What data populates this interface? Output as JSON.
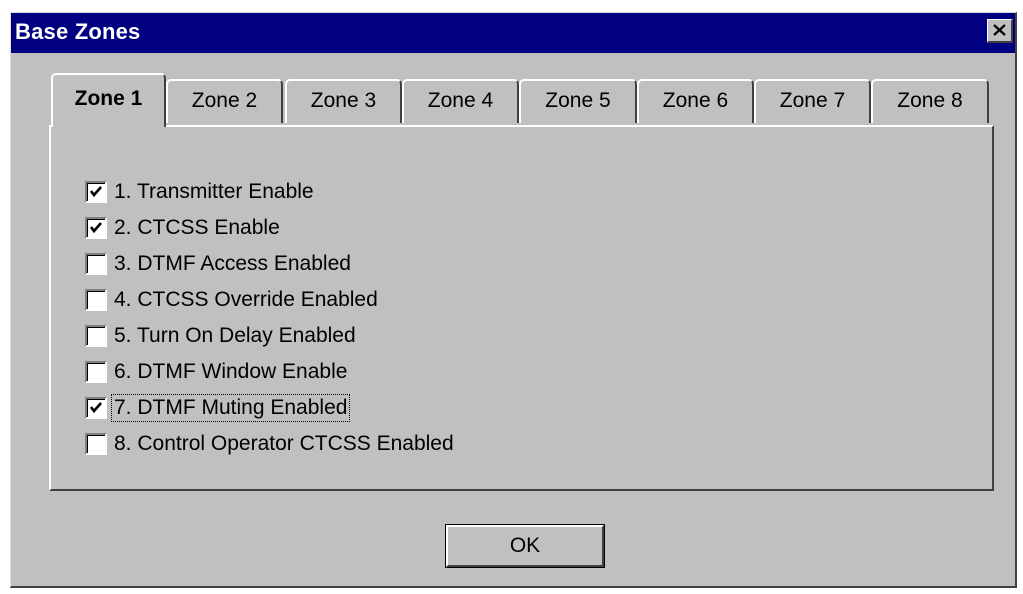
{
  "window": {
    "title": "Base Zones",
    "close_icon": "close-icon"
  },
  "tabs": [
    {
      "label": "Zone 1",
      "selected": true
    },
    {
      "label": "Zone 2",
      "selected": false
    },
    {
      "label": "Zone 3",
      "selected": false
    },
    {
      "label": "Zone 4",
      "selected": false
    },
    {
      "label": "Zone 5",
      "selected": false
    },
    {
      "label": "Zone 6",
      "selected": false
    },
    {
      "label": "Zone 7",
      "selected": false
    },
    {
      "label": "Zone 8",
      "selected": false
    }
  ],
  "options": [
    {
      "label": "1.  Transmitter Enable",
      "checked": true
    },
    {
      "label": "2.  CTCSS Enable",
      "checked": true
    },
    {
      "label": "3.  DTMF Access Enabled",
      "checked": false
    },
    {
      "label": "4.  CTCSS Override Enabled",
      "checked": false
    },
    {
      "label": "5.  Turn On Delay Enabled",
      "checked": false
    },
    {
      "label": "6.  DTMF Window Enable",
      "checked": false
    },
    {
      "label": "7.  DTMF Muting Enabled",
      "checked": true,
      "focused": true
    },
    {
      "label": "8.  Control Operator CTCSS Enabled",
      "checked": false
    }
  ],
  "buttons": {
    "ok_label": "OK"
  },
  "colors": {
    "titlebar": "#000080",
    "face": "#c0c0c0"
  }
}
